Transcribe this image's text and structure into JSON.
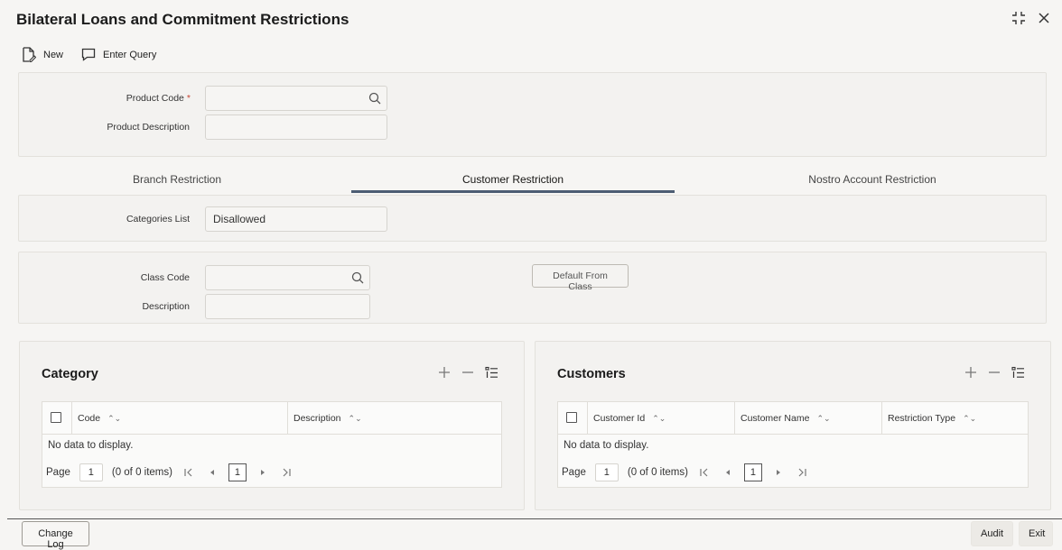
{
  "window": {
    "title": "Bilateral Loans and Commitment Restrictions"
  },
  "toolbar": {
    "new_label": "New",
    "enter_query_label": "Enter Query"
  },
  "product": {
    "code_label": "Product Code",
    "required_mark": "*",
    "code_value": "",
    "description_label": "Product Description",
    "description_value": ""
  },
  "tabs": [
    {
      "label": "Branch Restriction",
      "active": false
    },
    {
      "label": "Customer Restriction",
      "active": true
    },
    {
      "label": "Nostro Account Restriction",
      "active": false
    }
  ],
  "categories": {
    "label": "Categories List",
    "value": "Disallowed"
  },
  "class": {
    "code_label": "Class Code",
    "code_value": "",
    "description_label": "Description",
    "description_value": "",
    "default_button": "Default From Class"
  },
  "category_grid": {
    "title": "Category",
    "columns": [
      "Code",
      "Description"
    ],
    "no_data": "No data to display.",
    "page_label": "Page",
    "page_value": "1",
    "items_text": "(0 of 0 items)",
    "current_page": "1"
  },
  "customers_grid": {
    "title": "Customers",
    "columns": [
      "Customer Id",
      "Customer Name",
      "Restriction Type"
    ],
    "no_data": "No data to display.",
    "page_label": "Page",
    "page_value": "1",
    "items_text": "(0 of 0 items)",
    "current_page": "1"
  },
  "footer": {
    "change_log": "Change Log",
    "audit": "Audit",
    "exit": "Exit"
  },
  "colors": {
    "active_tab_underline": "#4c5d73",
    "required": "#c74634"
  }
}
